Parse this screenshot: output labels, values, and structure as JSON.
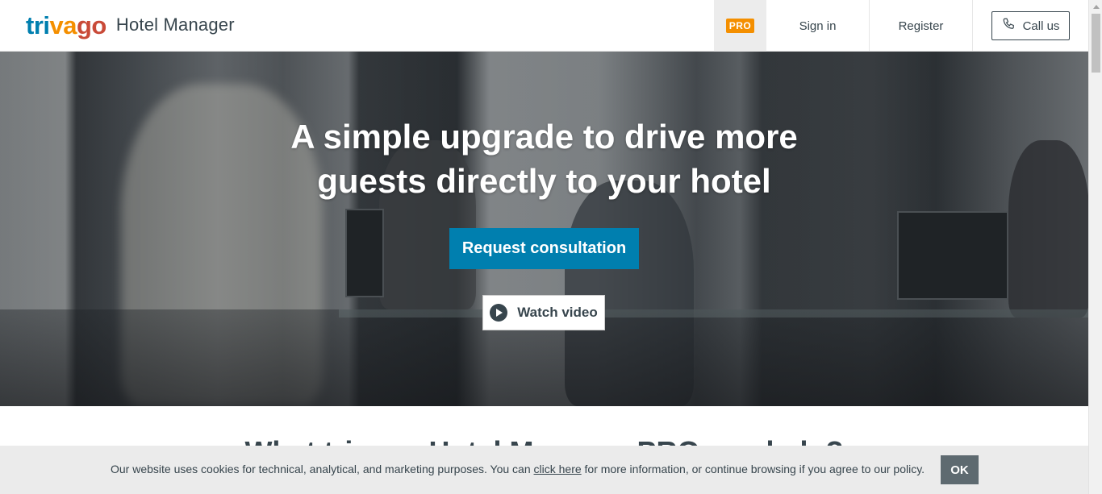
{
  "header": {
    "logo": {
      "part1": "tri",
      "part2": "va",
      "part3": "go",
      "product": "Hotel Manager"
    },
    "pro_badge": "PRO",
    "sign_in": "Sign in",
    "register": "Register",
    "call_us": "Call us"
  },
  "hero": {
    "title_line1": "A simple upgrade to drive more",
    "title_line2": "guests directly to your hotel",
    "cta": "Request consultation",
    "watch_video": "Watch video"
  },
  "section": {
    "heading": "What trivago Hotel Manager PRO can help?"
  },
  "cookie": {
    "text_before": "Our website uses cookies for technical, analytical, and marketing purposes. You can ",
    "link": "click here",
    "text_after": " for more information, or continue browsing if you agree to our policy.",
    "ok": "OK"
  },
  "colors": {
    "brand_blue": "#007faf",
    "brand_orange": "#f48f00",
    "brand_red": "#c94a38",
    "text_dark": "#37454d",
    "ok_button": "#5e6a70"
  }
}
